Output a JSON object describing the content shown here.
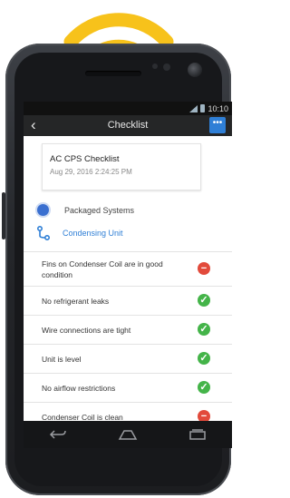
{
  "status_bar": {
    "time": "10:10"
  },
  "app_bar": {
    "title": "Checklist",
    "back_icon": "back-arrow-icon",
    "menu_icon": "more-horiz-icon"
  },
  "checklist_card": {
    "title": "AC CPS Checklist",
    "date": "Aug 29, 2016 2:24:25 PM"
  },
  "sections": [
    {
      "label": "Packaged Systems",
      "icon": "circle-dot-icon"
    },
    {
      "label": "Condensing Unit",
      "icon": "branch-icon"
    }
  ],
  "checklist_items": [
    {
      "label": "Fins on Condenser Coil are in good condition",
      "status": "fail"
    },
    {
      "label": "No refrigerant leaks",
      "status": "pass"
    },
    {
      "label": "Wire connections are tight",
      "status": "pass"
    },
    {
      "label": "Unit is level",
      "status": "pass"
    },
    {
      "label": "No airflow restrictions",
      "status": "pass"
    },
    {
      "label": "Condenser Coil is clean",
      "status": "fail"
    }
  ],
  "colors": {
    "pass": "#44b449",
    "fail": "#e24a3b",
    "accent": "#2f7fd6",
    "wifi": "#f7c21b"
  },
  "nav": [
    "back-nav-icon",
    "home-nav-icon",
    "recents-nav-icon"
  ]
}
